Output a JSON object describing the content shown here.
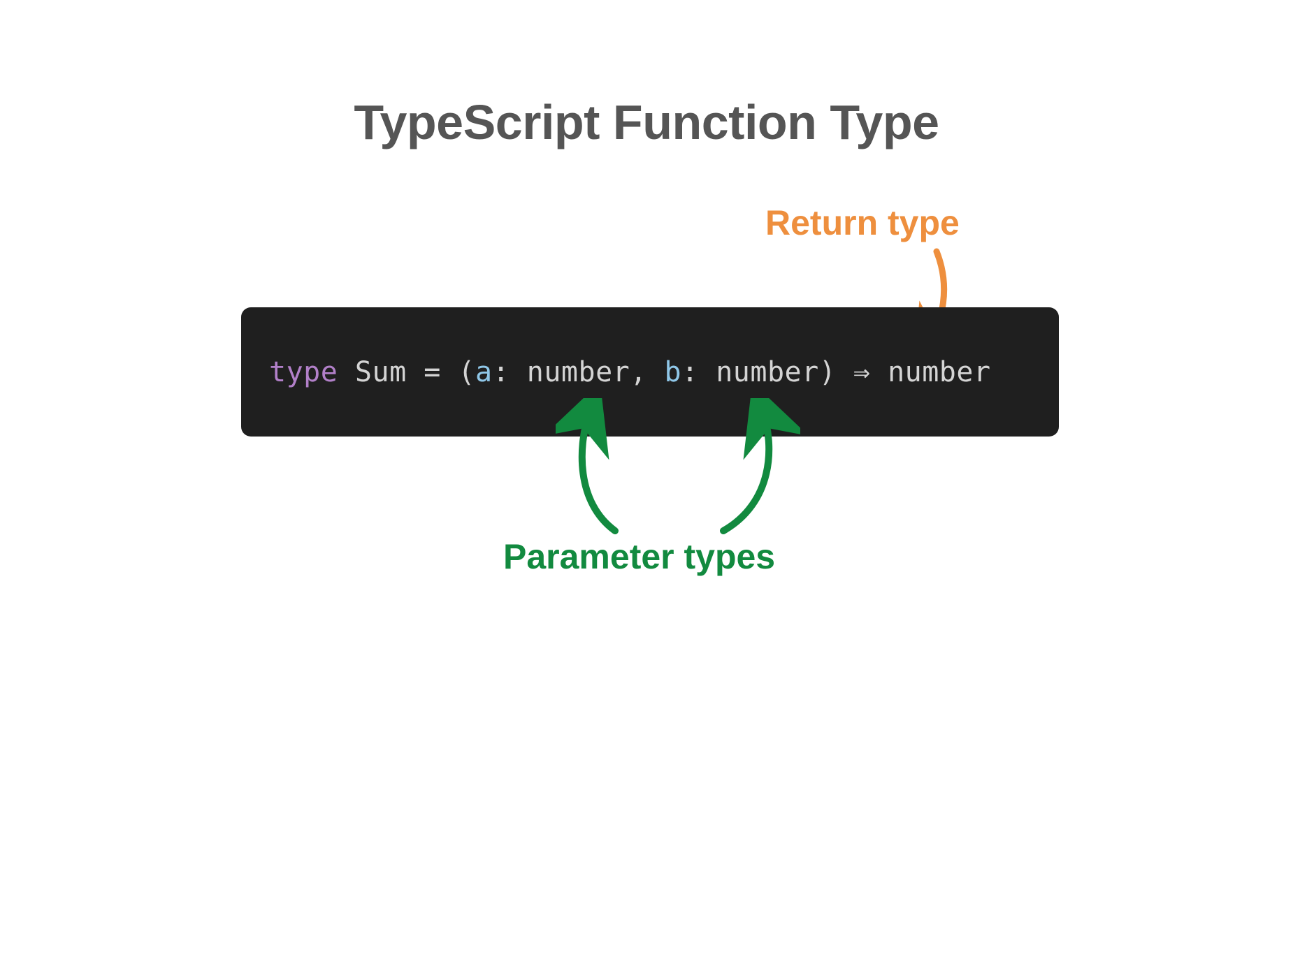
{
  "title": "TypeScript Function Type",
  "annotations": {
    "return": {
      "label": "Return type",
      "color": "#ee8f3e"
    },
    "params": {
      "label": "Parameter types",
      "color": "#128a3f"
    }
  },
  "code": {
    "tokens": [
      {
        "text": "type",
        "color": "#b280c9"
      },
      {
        "text": " ",
        "color": "#d4d4d4"
      },
      {
        "text": "Sum",
        "color": "#d4d4d4"
      },
      {
        "text": " = (",
        "color": "#d4d4d4"
      },
      {
        "text": "a",
        "color": "#8fc7e8"
      },
      {
        "text": ": ",
        "color": "#d4d4d4"
      },
      {
        "text": "number",
        "color": "#d4d4d4"
      },
      {
        "text": ", ",
        "color": "#d4d4d4"
      },
      {
        "text": "b",
        "color": "#8fc7e8"
      },
      {
        "text": ": ",
        "color": "#d4d4d4"
      },
      {
        "text": "number",
        "color": "#d4d4d4"
      },
      {
        "text": ") ",
        "color": "#d4d4d4"
      },
      {
        "text": "⇒",
        "color": "#d4d4d4"
      },
      {
        "text": " ",
        "color": "#d4d4d4"
      },
      {
        "text": "number",
        "color": "#d4d4d4"
      }
    ]
  }
}
